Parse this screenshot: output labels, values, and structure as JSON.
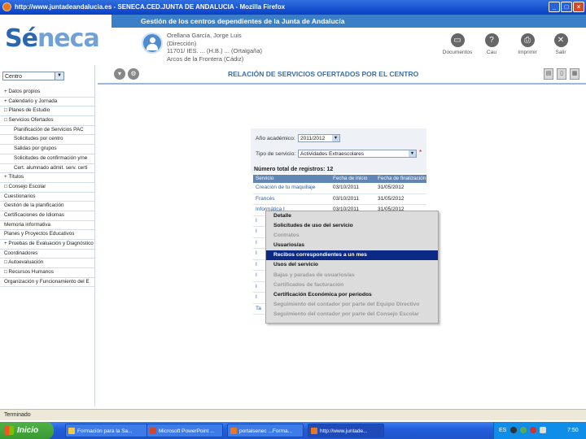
{
  "window": {
    "title": "http://www.juntadeandalucia.es - SENECA.CED.JUNTA DE ANDALUCIA - Mozilla Firefox",
    "buttons": {
      "minimize": "_",
      "maximize": "□",
      "close": "×"
    }
  },
  "header": {
    "band_title": "Gestión de los centros dependientes de la Junta de Andalucía",
    "logo_part1": "Sé",
    "logo_part2": "neca",
    "user_name": "Orellana García, Jorge Luis",
    "user_role": "(Dirección)",
    "user_center": "11701/ IES. ... (H.B.) ... (Ortalgaña)",
    "user_location": "Arcos de la Frontera (Cádiz)",
    "actions": [
      {
        "label": "Documentos",
        "icon": "document-icon"
      },
      {
        "label": "Cau",
        "icon": "help-icon"
      },
      {
        "label": "Imprimir",
        "icon": "print-icon"
      },
      {
        "label": "Salir",
        "icon": "exit-icon"
      }
    ]
  },
  "sidebar": {
    "centro_value": "Centro",
    "items": [
      {
        "label": "+ Datos propios",
        "sub": false
      },
      {
        "label": "+ Calendario y Jornada",
        "sub": false
      },
      {
        "label": "□ Planes de Estudio",
        "sub": false
      },
      {
        "label": "□ Servicios Ofertados",
        "sub": false
      },
      {
        "label": "Planificación de Servicios PAC",
        "sub": true
      },
      {
        "label": "Solicitudes por centro",
        "sub": true
      },
      {
        "label": "Salidas por grupos",
        "sub": true
      },
      {
        "label": "Solicitudes de confirmación y/ne",
        "sub": true
      },
      {
        "label": "Cert. alumnado admit. serv. certi",
        "sub": true
      },
      {
        "label": "+ Títulos",
        "sub": false
      },
      {
        "label": "□ Consejo Escolar",
        "sub": false
      },
      {
        "label": "Cuestionarios",
        "sub": false
      },
      {
        "label": "Gestión de la planificación",
        "sub": false
      },
      {
        "label": "Certificaciones de Idiomas",
        "sub": false
      },
      {
        "label": "Memoria informativa",
        "sub": false
      },
      {
        "label": "Planes y Proyectos Educativos",
        "sub": false
      },
      {
        "label": "+ Pruebas de Evaluación y Diagnóstico",
        "sub": false
      },
      {
        "label": "Coordinadores",
        "sub": false
      },
      {
        "label": "□ Autoevaluación",
        "sub": false
      },
      {
        "label": "□ Recursos Humanos",
        "sub": false
      },
      {
        "label": "Organización y Funcionamiento del E",
        "sub": false
      }
    ]
  },
  "content": {
    "title": "RELACIÓN DE SERVICIOS OFERTADOS POR EL CENTRO",
    "form": {
      "year_label": "Año académico:",
      "year_value": "2011/2012",
      "type_label": "Tipo de servicio:",
      "type_value": "Actividades Extraescolares",
      "required_mark": "*"
    },
    "total_label": "Número total de registros: 12",
    "table": {
      "headers": [
        "Servicio",
        "Fecha de inicio",
        "Fecha de finalización"
      ],
      "rows": [
        [
          "Creación de tu maquillaje",
          "03/10/2011",
          "31/05/2012"
        ],
        [
          "Francés",
          "03/10/2011",
          "31/05/2012"
        ],
        [
          "Informática I",
          "03/10/2011",
          "31/05/2012"
        ],
        [
          "I",
          "",
          ""
        ],
        [
          "I",
          "",
          ""
        ],
        [
          "I",
          "",
          ""
        ],
        [
          "I",
          "",
          ""
        ],
        [
          "I",
          "",
          ""
        ],
        [
          "I",
          "",
          ""
        ],
        [
          "I",
          "",
          ""
        ],
        [
          "I",
          "",
          ""
        ],
        [
          "Ta",
          "",
          ""
        ]
      ]
    },
    "context_menu": [
      {
        "label": "Detalle",
        "state": "normal"
      },
      {
        "label": "Solicitudes de uso del servicio",
        "state": "normal"
      },
      {
        "label": "Contratos",
        "state": "disabled"
      },
      {
        "label": "Usuarios/as",
        "state": "normal"
      },
      {
        "label": "Recibos correspondientes a un mes",
        "state": "selected"
      },
      {
        "label": "Usos del servicio",
        "state": "normal"
      },
      {
        "label": "Bajas y paradas de usuarios/as",
        "state": "disabled"
      },
      {
        "label": "Certificados de facturación",
        "state": "disabled"
      },
      {
        "label": "Certificación Económica por periodos",
        "state": "normal"
      },
      {
        "label": "Seguimiento del contador por parte del Equipo Directivo",
        "state": "disabled"
      },
      {
        "label": "Seguimiento del contador por parte del Consejo Escolar",
        "state": "disabled"
      }
    ]
  },
  "status": {
    "text": "Terminado"
  },
  "taskbar": {
    "start_label": "Inicio",
    "tasks": [
      "Formación para la Sa...",
      "Microsoft PowerPoint ...",
      "portalsenec ...Forma...",
      "http://www.juntade..."
    ],
    "tray_lang": "ES",
    "clock": "7:50"
  },
  "colors": {
    "band": "#3a7fc8",
    "selected": "#0a2a86",
    "header_row": "#5f86b5"
  }
}
